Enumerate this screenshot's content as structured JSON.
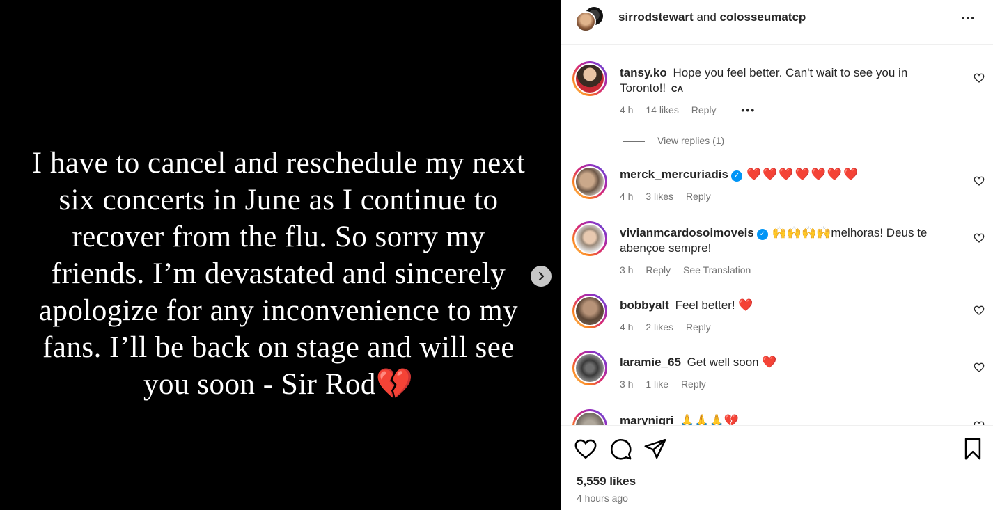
{
  "post": {
    "text": "I have to cancel and reschedule my next six concerts in June as I continue to recover from the flu. So sorry my friends. I’m devastated and sincerely apologize for any inconvenience to my fans. I’ll be back on stage and will see you soon - Sir Rod💔"
  },
  "header": {
    "user1": "sirrodstewart",
    "and": "and",
    "user2": "colosseumatcp",
    "more_icon": "more-horizontal-icon"
  },
  "comments": [
    {
      "user": "tansy.ko",
      "text": "Hope you feel better. Can't wait to see you in Toronto!!",
      "badge": "CA",
      "time": "4 h",
      "likes": "14 likes",
      "reply": "Reply",
      "view_replies": "View replies (1)"
    },
    {
      "user": "merck_mercuriadis",
      "verified": true,
      "text": "❤️❤️❤️❤️❤️❤️❤️",
      "time": "4 h",
      "likes": "3 likes",
      "reply": "Reply"
    },
    {
      "user": "vivianmcardosoimoveis",
      "verified": true,
      "text": "🙌🙌🙌🙌melhoras! Deus te abençoe sempre!",
      "time": "3 h",
      "reply": "Reply",
      "translate": "See Translation"
    },
    {
      "user": "bobbyalt",
      "text": "Feel better! ❤️",
      "time": "4 h",
      "likes": "2 likes",
      "reply": "Reply"
    },
    {
      "user": "laramie_65",
      "text": "Get well soon ❤️",
      "time": "3 h",
      "likes": "1 like",
      "reply": "Reply"
    },
    {
      "user": "marynigri",
      "text": "🙏🙏🙏💔"
    }
  ],
  "footer": {
    "likes": "5,559 likes",
    "time": "4 hours ago"
  },
  "colors": {
    "accent": "#0095f6",
    "heart": "#e0143c",
    "muted": "#737373"
  }
}
